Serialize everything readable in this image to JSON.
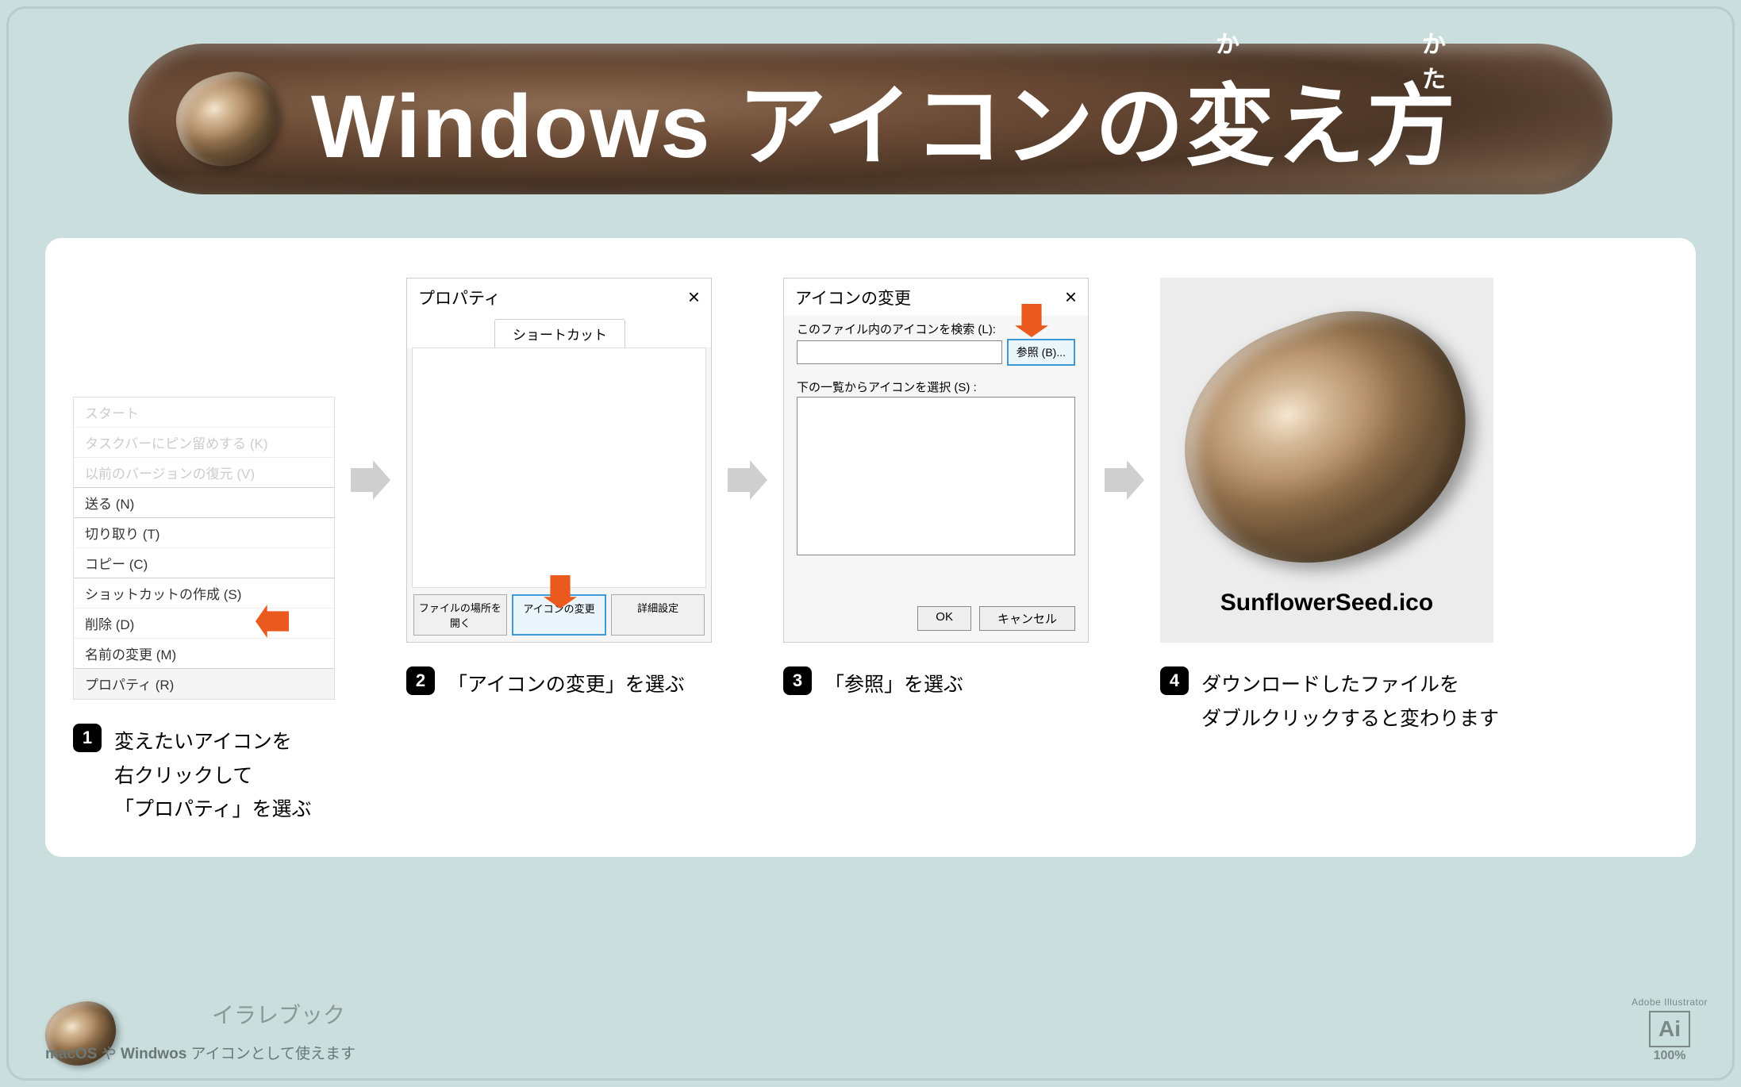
{
  "title": {
    "main": "Windows アイコンの変え方",
    "ruby_ka": "か",
    "ruby_kata": "かた"
  },
  "steps": {
    "s1": {
      "num": "1",
      "text": "変えたいアイコンを\n右クリックして\n「プロパティ」を選ぶ",
      "menu": {
        "items_faded": [
          "スタート",
          "タスクバーにピン留めする (K)",
          "以前のバージョンの復元 (V)"
        ],
        "send": "送る (N)",
        "cut": "切り取り (T)",
        "copy": "コピー (C)",
        "shortcut": "ショットカットの作成 (S)",
        "delete": "削除 (D)",
        "rename": "名前の変更 (M)",
        "properties": "プロパティ (R)"
      }
    },
    "s2": {
      "num": "2",
      "text": "「アイコンの変更」を選ぶ",
      "dlg": {
        "title": "プロパティ",
        "tab": "ショートカット",
        "btn_open": "ファイルの場所を開く",
        "btn_change": "アイコンの変更",
        "btn_adv": "詳細設定"
      }
    },
    "s3": {
      "num": "3",
      "text": "「参照」を選ぶ",
      "dlg": {
        "title": "アイコンの変更",
        "label_search": "このファイル内のアイコンを検索 (L):",
        "browse": "参照 (B)...",
        "label_list": "下の一覧からアイコンを選択 (S) :",
        "ok": "OK",
        "cancel": "キャンセル"
      }
    },
    "s4": {
      "num": "4",
      "text": "ダウンロードしたファイルを\nダブルクリックすると変わります",
      "filename": "SunflowerSeed.ico"
    }
  },
  "footer": {
    "brand": "イラレブック",
    "sub_prefix": "macOS",
    "sub_mid": " や ",
    "sub_bold": "Windwos",
    "sub_rest": " アイコンとして使えます",
    "ai_top": "Adobe Illustrator",
    "ai_mark": "Ai",
    "ai_pct": "100%"
  }
}
